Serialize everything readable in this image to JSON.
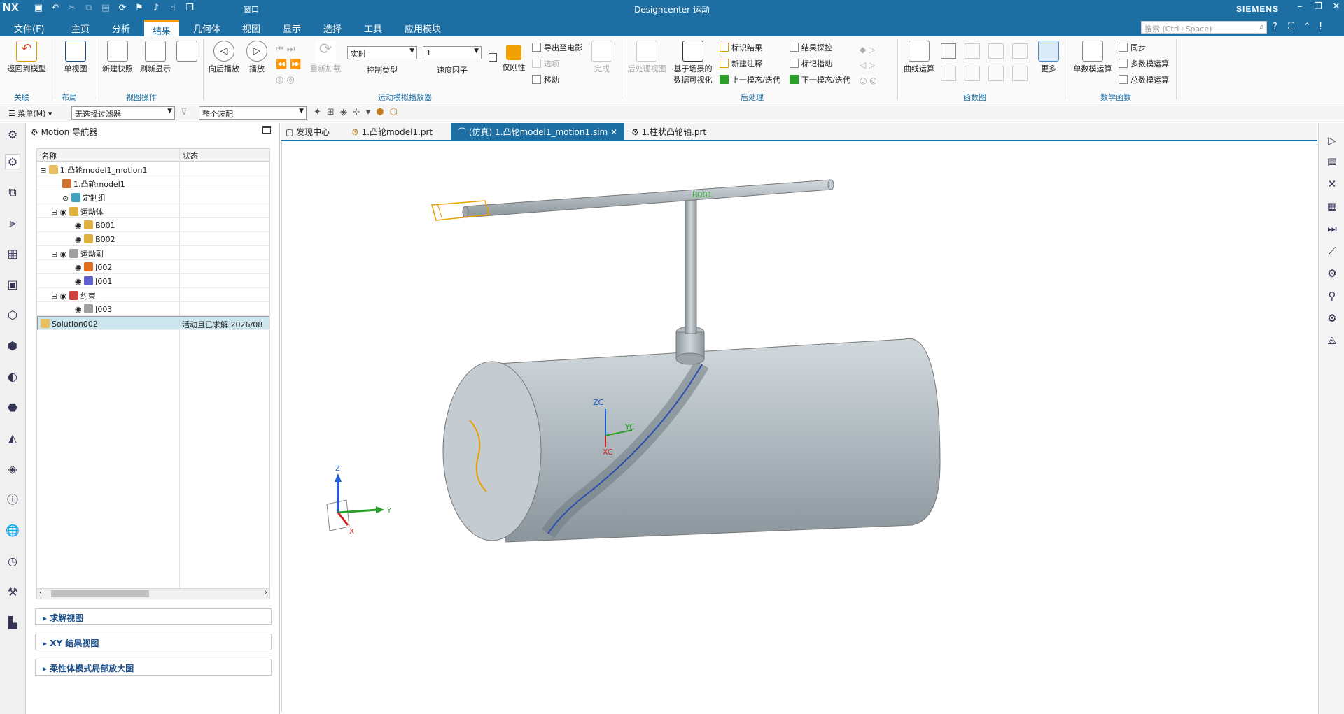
{
  "titlebar": {
    "logo": "NX",
    "title": "Designcenter 运动",
    "brand": "SIEMENS",
    "window_menu": "窗口"
  },
  "menubar": {
    "items": [
      "文件(F)",
      "主页",
      "分析",
      "结果",
      "几何体",
      "视图",
      "显示",
      "选择",
      "工具",
      "应用模块"
    ],
    "active": "结果",
    "search_placeholder": "搜索 (Ctrl+Space)"
  },
  "ribbon": {
    "groups": {
      "link": "关联",
      "layout": "布局",
      "view_ops": "视图操作",
      "player": "运动模拟播放器",
      "post": "后处理",
      "functions": "函数图",
      "math": "数学函数"
    },
    "buttons": {
      "return_model": "返回到模型",
      "single_view": "单视图",
      "new_snapshot": "新建快照",
      "refresh_display": "刷新显示",
      "play_back": "向后播放",
      "play": "播放",
      "reload": "重新加载",
      "control_type_label": "控制类型",
      "control_type_value": "实时",
      "speed_label": "速度因子",
      "speed_value": "1",
      "rigid_only": "仅刚性",
      "export_movie": "导出至电影",
      "options": "选项",
      "move": "移动",
      "finish": "完成",
      "post_view": "后处理视图",
      "scene_data": "基于场景的",
      "scene_data2": "数据可视化",
      "mark_result": "标识结果",
      "new_annotation": "新建注释",
      "prev_mode": "上一模态/迭代",
      "result_probe": "结果探控",
      "mark_marker": "标记指动",
      "next_mode": "下一模态/迭代",
      "curve_calc": "曲线运算",
      "more": "更多",
      "single_calc": "单数模运算",
      "sync": "同步",
      "multi_calc": "多数模运算",
      "total_calc": "总数模运算"
    }
  },
  "filterbar": {
    "menu": "菜单(M)",
    "filter": "无选择过滤器",
    "assembly": "整个装配"
  },
  "navigator": {
    "title": "Motion 导航器",
    "col_name": "名称",
    "col_status": "状态",
    "rows": [
      {
        "name": "1.凸轮model1_motion1",
        "status": ""
      },
      {
        "name": "1.凸轮model1",
        "status": ""
      },
      {
        "name": "定制组",
        "status": ""
      },
      {
        "name": "运动体",
        "status": ""
      },
      {
        "name": "B001",
        "status": ""
      },
      {
        "name": "B002",
        "status": ""
      },
      {
        "name": "运动副",
        "status": ""
      },
      {
        "name": "J002",
        "status": ""
      },
      {
        "name": "J001",
        "status": ""
      },
      {
        "name": "约束",
        "status": ""
      },
      {
        "name": "J003",
        "status": ""
      },
      {
        "name": "Solution002",
        "status": "活动且已求解   2026/08"
      }
    ],
    "panels": [
      "求解视图",
      "XY 结果视图",
      "柔性体模式局部放大图"
    ]
  },
  "tabs": [
    {
      "label": "发现中心"
    },
    {
      "label": "1.凸轮model1.prt"
    },
    {
      "label": "(仿真) 1.凸轮model1_motion1.sim"
    },
    {
      "label": "1.柱状凸轮轴.prt"
    }
  ],
  "viewport": {
    "body_label": "B001",
    "axes": {
      "zc": "ZC",
      "yc": "YC",
      "xc": "XC"
    },
    "triad": {
      "z": "Z",
      "y": "Y",
      "x": "X"
    },
    "colors": {
      "body": "#b8c2c8",
      "accent": "#e8a000",
      "blue_axis": "#1e5fd6",
      "green_axis": "#2aa02a",
      "red_axis": "#d02020"
    }
  }
}
